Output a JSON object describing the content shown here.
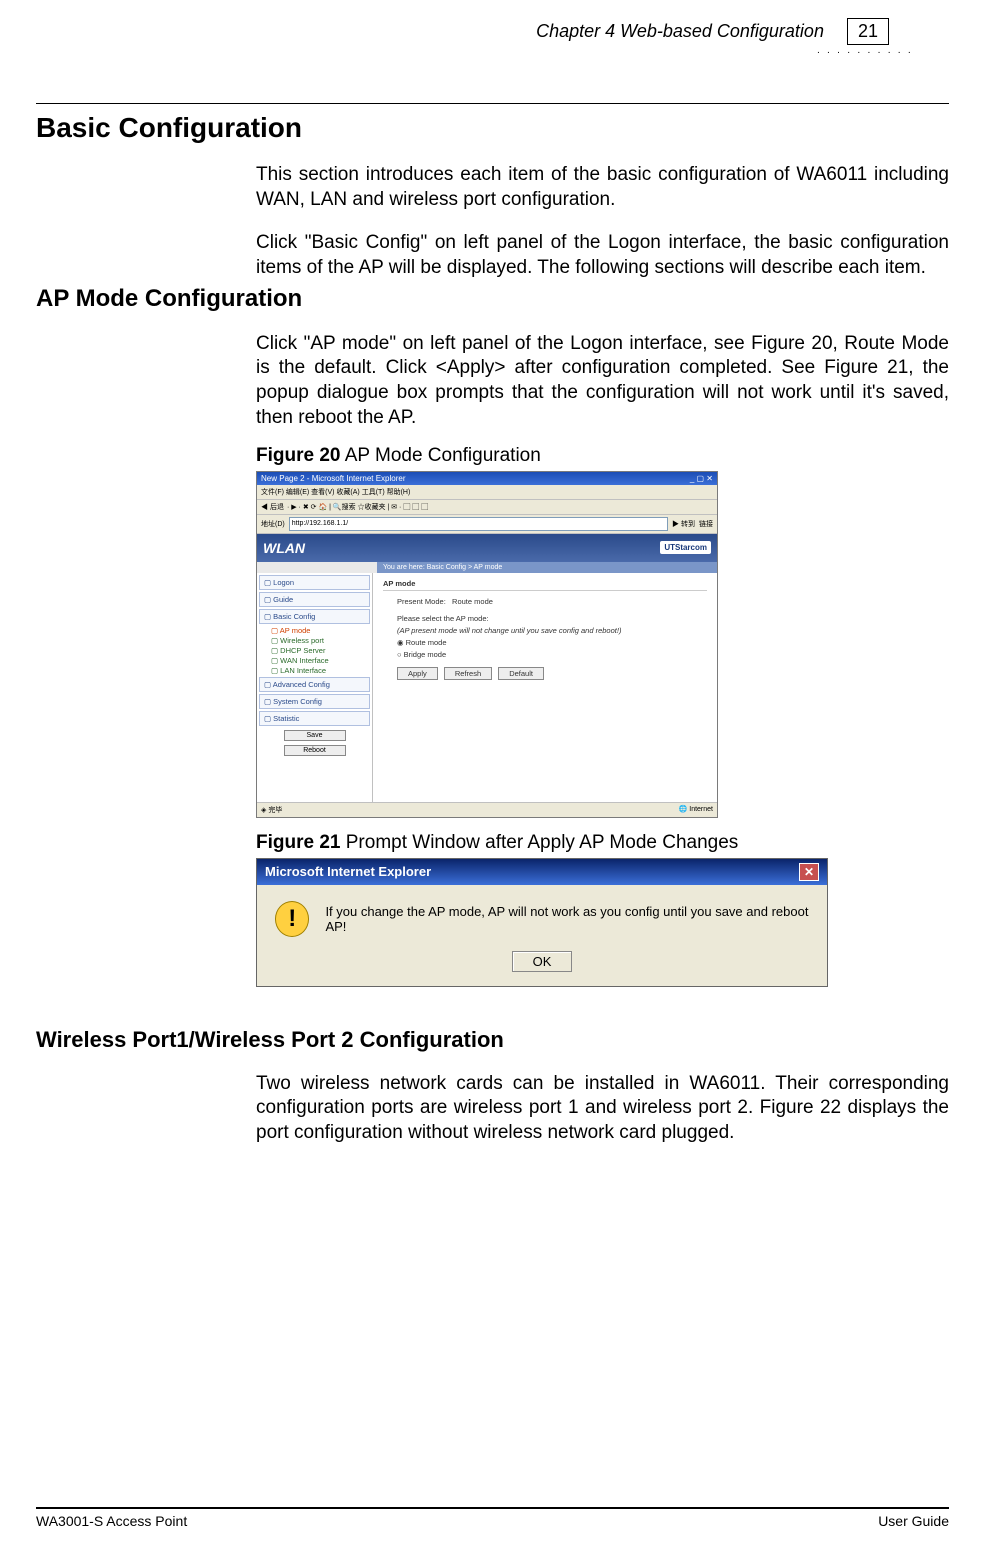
{
  "header": {
    "chapter": "Chapter 4 Web-based Configuration",
    "page_number": "21"
  },
  "sections": {
    "basic_config": {
      "title": "Basic Configuration",
      "p1": "This section introduces each item of the basic configuration of WA6011 including WAN, LAN and wireless port configuration.",
      "p2": "Click \"Basic Config\" on left panel of the Logon interface, the basic configuration items of the AP will be displayed. The following sections will describe each item."
    },
    "ap_mode": {
      "title": "AP Mode Configuration",
      "p1": "Click \"AP mode\" on left panel of the Logon interface, see Figure 20, Route Mode is the default. Click <Apply> after configuration completed. See Figure 21, the popup dialogue box prompts that the configuration will not work until it's saved, then reboot the AP."
    },
    "wireless_port": {
      "title": "Wireless Port1/Wireless Port 2 Configuration",
      "p1": "Two wireless network cards can be installed in WA6011. Their corresponding configuration ports are wireless port 1 and wireless port 2. Figure 22 displays the port configuration without wireless network card plugged."
    }
  },
  "figures": {
    "f20": {
      "label": "Figure 20",
      "caption": " AP Mode Configuration",
      "ie_title": "New Page 2 - Microsoft Internet Explorer",
      "ie_menu": "文件(F)  编辑(E)  查看(V)  收藏(A)  工具(T)  帮助(H)",
      "address_label": "地址(D)",
      "address_value": "http://192.168.1.1/",
      "go_label": "转到",
      "links_label": "链接",
      "wlan_brand": "WLAN",
      "logo": "UTStarcom",
      "breadcrumb": "You are here:  Basic Config > AP mode",
      "nav": {
        "logon": "Logon",
        "guide": "Guide",
        "basic": "Basic Config",
        "ap_mode": "AP mode",
        "wireless_port": "Wireless port",
        "dhcp": "DHCP Server",
        "wan": "WAN Interface",
        "lan": "LAN Interface",
        "advanced": "Advanced Config",
        "system": "System Config",
        "statistic": "Statistic",
        "save": "Save",
        "reboot": "Reboot"
      },
      "panel": {
        "title": "AP mode",
        "present_label": "Present Mode:",
        "present_value": "Route mode",
        "select_label": "Please select the AP mode:",
        "note": "(AP present mode will not change until you save config and reboot!)",
        "opt_route": "Route mode",
        "opt_bridge": "Bridge mode",
        "apply": "Apply",
        "refresh": "Refresh",
        "default": "Default"
      },
      "status_done": "完毕",
      "status_internet": "Internet"
    },
    "f21": {
      "label": "Figure 21",
      "caption": " Prompt Window after Apply AP Mode Changes",
      "dlg_title": "Microsoft Internet Explorer",
      "msg": "If you change the AP mode, AP will not work as you config until you save and reboot AP!",
      "ok": "OK"
    }
  },
  "footer": {
    "left": "WA3001-S Access Point",
    "right": "User Guide"
  }
}
